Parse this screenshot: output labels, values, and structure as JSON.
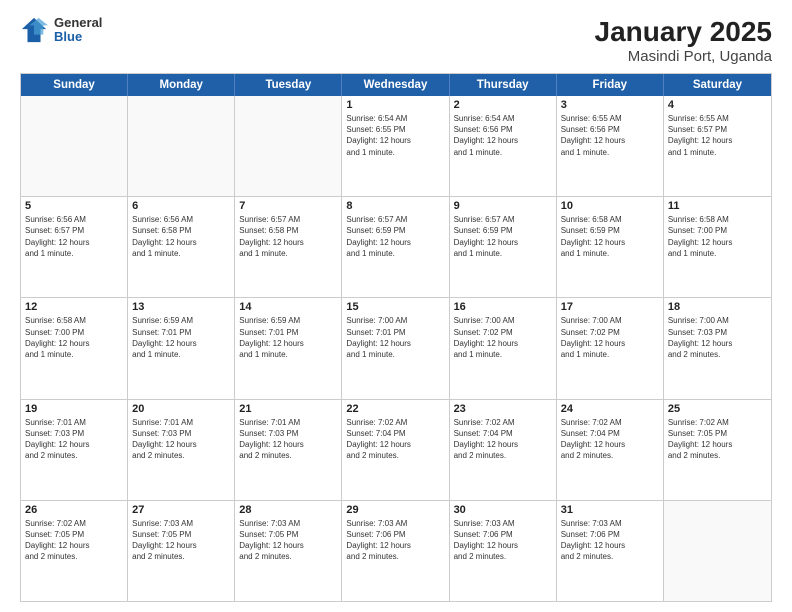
{
  "header": {
    "logo": {
      "general": "General",
      "blue": "Blue"
    },
    "title": "January 2025",
    "subtitle": "Masindi Port, Uganda"
  },
  "calendar": {
    "headers": [
      "Sunday",
      "Monday",
      "Tuesday",
      "Wednesday",
      "Thursday",
      "Friday",
      "Saturday"
    ],
    "weeks": [
      [
        {
          "day": "",
          "info": ""
        },
        {
          "day": "",
          "info": ""
        },
        {
          "day": "",
          "info": ""
        },
        {
          "day": "1",
          "info": "Sunrise: 6:54 AM\nSunset: 6:55 PM\nDaylight: 12 hours\nand 1 minute."
        },
        {
          "day": "2",
          "info": "Sunrise: 6:54 AM\nSunset: 6:56 PM\nDaylight: 12 hours\nand 1 minute."
        },
        {
          "day": "3",
          "info": "Sunrise: 6:55 AM\nSunset: 6:56 PM\nDaylight: 12 hours\nand 1 minute."
        },
        {
          "day": "4",
          "info": "Sunrise: 6:55 AM\nSunset: 6:57 PM\nDaylight: 12 hours\nand 1 minute."
        }
      ],
      [
        {
          "day": "5",
          "info": "Sunrise: 6:56 AM\nSunset: 6:57 PM\nDaylight: 12 hours\nand 1 minute."
        },
        {
          "day": "6",
          "info": "Sunrise: 6:56 AM\nSunset: 6:58 PM\nDaylight: 12 hours\nand 1 minute."
        },
        {
          "day": "7",
          "info": "Sunrise: 6:57 AM\nSunset: 6:58 PM\nDaylight: 12 hours\nand 1 minute."
        },
        {
          "day": "8",
          "info": "Sunrise: 6:57 AM\nSunset: 6:59 PM\nDaylight: 12 hours\nand 1 minute."
        },
        {
          "day": "9",
          "info": "Sunrise: 6:57 AM\nSunset: 6:59 PM\nDaylight: 12 hours\nand 1 minute."
        },
        {
          "day": "10",
          "info": "Sunrise: 6:58 AM\nSunset: 6:59 PM\nDaylight: 12 hours\nand 1 minute."
        },
        {
          "day": "11",
          "info": "Sunrise: 6:58 AM\nSunset: 7:00 PM\nDaylight: 12 hours\nand 1 minute."
        }
      ],
      [
        {
          "day": "12",
          "info": "Sunrise: 6:58 AM\nSunset: 7:00 PM\nDaylight: 12 hours\nand 1 minute."
        },
        {
          "day": "13",
          "info": "Sunrise: 6:59 AM\nSunset: 7:01 PM\nDaylight: 12 hours\nand 1 minute."
        },
        {
          "day": "14",
          "info": "Sunrise: 6:59 AM\nSunset: 7:01 PM\nDaylight: 12 hours\nand 1 minute."
        },
        {
          "day": "15",
          "info": "Sunrise: 7:00 AM\nSunset: 7:01 PM\nDaylight: 12 hours\nand 1 minute."
        },
        {
          "day": "16",
          "info": "Sunrise: 7:00 AM\nSunset: 7:02 PM\nDaylight: 12 hours\nand 1 minute."
        },
        {
          "day": "17",
          "info": "Sunrise: 7:00 AM\nSunset: 7:02 PM\nDaylight: 12 hours\nand 1 minute."
        },
        {
          "day": "18",
          "info": "Sunrise: 7:00 AM\nSunset: 7:03 PM\nDaylight: 12 hours\nand 2 minutes."
        }
      ],
      [
        {
          "day": "19",
          "info": "Sunrise: 7:01 AM\nSunset: 7:03 PM\nDaylight: 12 hours\nand 2 minutes."
        },
        {
          "day": "20",
          "info": "Sunrise: 7:01 AM\nSunset: 7:03 PM\nDaylight: 12 hours\nand 2 minutes."
        },
        {
          "day": "21",
          "info": "Sunrise: 7:01 AM\nSunset: 7:03 PM\nDaylight: 12 hours\nand 2 minutes."
        },
        {
          "day": "22",
          "info": "Sunrise: 7:02 AM\nSunset: 7:04 PM\nDaylight: 12 hours\nand 2 minutes."
        },
        {
          "day": "23",
          "info": "Sunrise: 7:02 AM\nSunset: 7:04 PM\nDaylight: 12 hours\nand 2 minutes."
        },
        {
          "day": "24",
          "info": "Sunrise: 7:02 AM\nSunset: 7:04 PM\nDaylight: 12 hours\nand 2 minutes."
        },
        {
          "day": "25",
          "info": "Sunrise: 7:02 AM\nSunset: 7:05 PM\nDaylight: 12 hours\nand 2 minutes."
        }
      ],
      [
        {
          "day": "26",
          "info": "Sunrise: 7:02 AM\nSunset: 7:05 PM\nDaylight: 12 hours\nand 2 minutes."
        },
        {
          "day": "27",
          "info": "Sunrise: 7:03 AM\nSunset: 7:05 PM\nDaylight: 12 hours\nand 2 minutes."
        },
        {
          "day": "28",
          "info": "Sunrise: 7:03 AM\nSunset: 7:05 PM\nDaylight: 12 hours\nand 2 minutes."
        },
        {
          "day": "29",
          "info": "Sunrise: 7:03 AM\nSunset: 7:06 PM\nDaylight: 12 hours\nand 2 minutes."
        },
        {
          "day": "30",
          "info": "Sunrise: 7:03 AM\nSunset: 7:06 PM\nDaylight: 12 hours\nand 2 minutes."
        },
        {
          "day": "31",
          "info": "Sunrise: 7:03 AM\nSunset: 7:06 PM\nDaylight: 12 hours\nand 2 minutes."
        },
        {
          "day": "",
          "info": ""
        }
      ]
    ]
  }
}
